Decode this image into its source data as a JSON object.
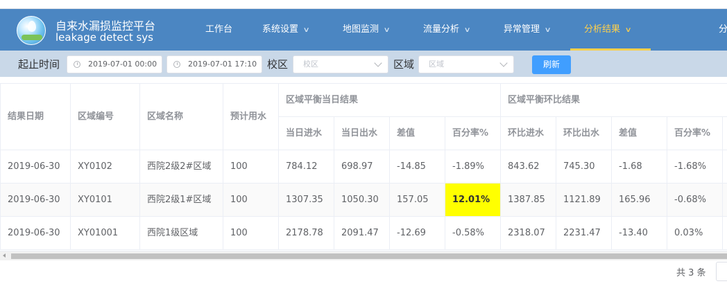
{
  "app": {
    "title_cn": "自来水漏损监控平台",
    "title_en": "leakage detect  sys"
  },
  "nav": {
    "items": [
      {
        "label": "工作台",
        "has_dropdown": false
      },
      {
        "label": "系统设置",
        "has_dropdown": true
      },
      {
        "label": "地图监测",
        "has_dropdown": true
      },
      {
        "label": "流量分析",
        "has_dropdown": true
      },
      {
        "label": "异常管理",
        "has_dropdown": true
      },
      {
        "label": "分析结果",
        "has_dropdown": true,
        "active": true
      },
      {
        "label": "分",
        "has_dropdown": false
      }
    ]
  },
  "filters": {
    "time_label": "起止时间",
    "start_time": "2019-07-01 00:00",
    "end_time": "2019-07-01 17:10",
    "campus_label": "校区",
    "campus_placeholder": "校区",
    "area_label": "区域",
    "area_placeholder": "区域",
    "refresh_label": "刷新"
  },
  "table": {
    "headers": {
      "date": "结果日期",
      "area_code": "区域编号",
      "area_name": "区域名称",
      "expected": "预计用水",
      "group_daily": "区域平衡当日结果",
      "group_mom": "区域平衡环比结果",
      "daily_in": "当日进水",
      "daily_out": "当日出水",
      "daily_diff": "差值",
      "daily_pct": "百分率%",
      "mom_in": "环比进水",
      "mom_out": "环比出水",
      "mom_diff": "差值",
      "mom_pct": "百分率%"
    },
    "rows": [
      {
        "date": "2019-06-30",
        "code": "XY0102",
        "name": "西院2级2#区域",
        "expected": "100",
        "d_in": "784.12",
        "d_out": "698.97",
        "d_diff": "-14.85",
        "d_pct": "-1.89%",
        "m_in": "843.62",
        "m_out": "745.30",
        "m_diff": "-1.68",
        "m_pct": "-1.68%"
      },
      {
        "date": "2019-06-30",
        "code": "XY0101",
        "name": "西院2级1#区域",
        "expected": "100",
        "d_in": "1307.35",
        "d_out": "1050.30",
        "d_diff": "157.05",
        "d_pct": "12.01%",
        "m_in": "1387.85",
        "m_out": "1121.89",
        "m_diff": "165.96",
        "m_pct": "-0.68%"
      },
      {
        "date": "2019-06-30",
        "code": "XY01001",
        "name": "西院1级区域",
        "expected": "100",
        "d_in": "2178.78",
        "d_out": "2091.47",
        "d_diff": "-12.69",
        "d_pct": "-0.58%",
        "m_in": "2318.07",
        "m_out": "2231.47",
        "m_diff": "-13.40",
        "m_pct": "0.03%"
      }
    ],
    "highlight_color": "#ffff00"
  },
  "pagination": {
    "total_text": "共 3 条"
  },
  "colors": {
    "header_bg": "#4b86c2",
    "active_nav": "#ffd04b",
    "filter_bg": "#c9d8e8",
    "refresh_btn": "#409eff"
  }
}
